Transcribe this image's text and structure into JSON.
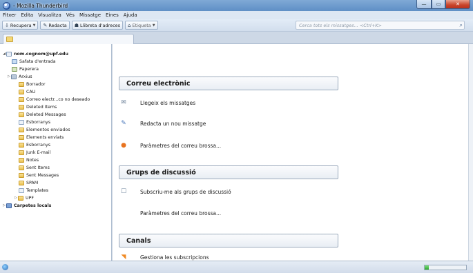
{
  "window": {
    "title": "- Mozilla Thunderbird",
    "controls": {
      "minimize": "—",
      "maximize": "▭",
      "close": "✕"
    }
  },
  "menu": [
    "Fitxer",
    "Edita",
    "Visualitza",
    "Vés",
    "Missatge",
    "Eines",
    "Ajuda"
  ],
  "toolbar": {
    "get_mail": "Recupera",
    "write": "Redacta",
    "address_book": "Llibreta d'adreces",
    "tag": "Etiqueta",
    "search_placeholder": "Cerca tots els missatges... <Ctrl+K>"
  },
  "folders": {
    "account": "nom.cognom@upf.edu",
    "items": [
      "Safata d'entrada",
      "Paperera",
      "Arxius",
      "Borrador",
      "CAU",
      "Correo electr...co no deseado",
      "Deleted Items",
      "Deleted Messages",
      "Esborranys",
      "Elementos enviados",
      "Elements enviats",
      "Esborranys",
      "Junk E-mail",
      "Notes",
      "Sent Items",
      "Sent Messages",
      "SPAM",
      "Templates",
      "UPF"
    ],
    "local": "Carpetes locals"
  },
  "content": {
    "email_header": "Correu electrònic",
    "read_messages": "Llegeix els missatges",
    "write_message": "Redacta un nou missatge",
    "junk_settings": "Paràmetres del correu brossa...",
    "newsgroups_header": "Grups de discussió",
    "subscribe": "Subscriu-me als grups de discussió",
    "newsgroup_junk": "Paràmetres del correu brossa...",
    "feeds_header": "Canals",
    "manage_subscriptions": "Gestiona les subscripcions"
  },
  "status": {
    "progress": 0.1
  }
}
